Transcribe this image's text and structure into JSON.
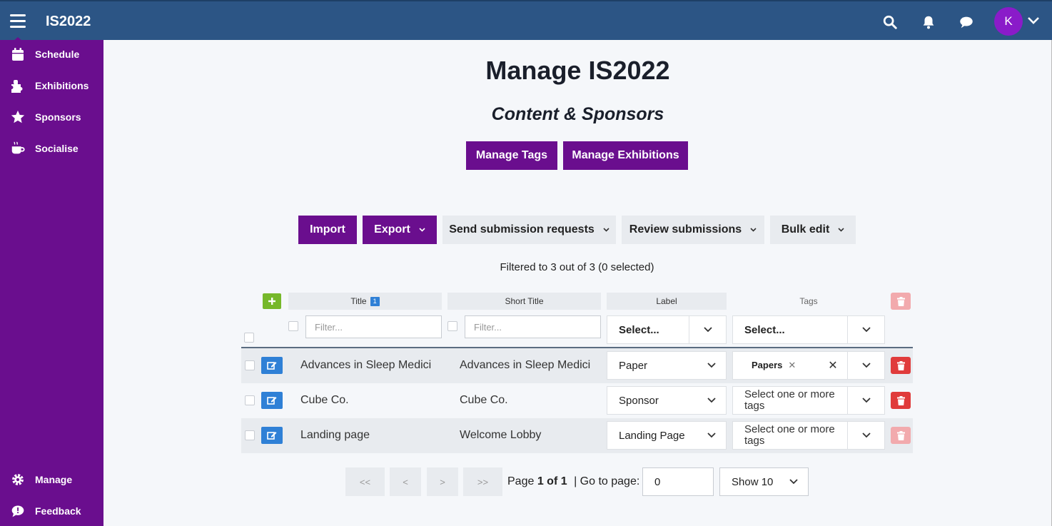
{
  "app": {
    "title": "IS2022",
    "avatar_initial": "K"
  },
  "topbar_icons": [
    "search-icon",
    "bell-icon",
    "chat-icon"
  ],
  "sidebar": {
    "items": [
      {
        "label": "Schedule",
        "icon": "calendar-icon"
      },
      {
        "label": "Exhibitions",
        "icon": "puzzle-icon"
      },
      {
        "label": "Sponsors",
        "icon": "star-icon"
      },
      {
        "label": "Socialise",
        "icon": "coffee-icon"
      }
    ],
    "bottom_items": [
      {
        "label": "Manage",
        "icon": "gear-icon"
      },
      {
        "label": "Feedback",
        "icon": "feedback-icon"
      }
    ]
  },
  "page": {
    "title": "Manage IS2022",
    "subtitle": "Content & Sponsors",
    "manage_tags": "Manage Tags",
    "manage_exhibitions": "Manage Exhibitions"
  },
  "toolbar": {
    "import": "Import",
    "export": "Export",
    "send_requests": "Send submission requests",
    "review": "Review submissions",
    "bulk_edit": "Bulk edit"
  },
  "filter_summary": "Filtered to 3 out of 3 (0 selected)",
  "table": {
    "headers": {
      "title": "Title",
      "sort_badge": "1",
      "short_title": "Short Title",
      "label": "Label",
      "tags": "Tags"
    },
    "filter_placeholder": "Filter...",
    "select_placeholder": "Select...",
    "rows": [
      {
        "title": "Advances in Sleep Medicine",
        "short_title": "Advances in Sleep Medicine",
        "label": "Paper",
        "tag": "Papers",
        "tags_placeholder": ""
      },
      {
        "title": "Cube Co.",
        "short_title": "Cube Co.",
        "label": "Sponsor",
        "tag": "",
        "tags_placeholder": "Select one or more tags"
      },
      {
        "title": "Landing page",
        "short_title": "Welcome Lobby",
        "label": "Landing Page",
        "tag": "",
        "tags_placeholder": "Select one or more tags"
      }
    ]
  },
  "pagination": {
    "first": "<<",
    "prev": "<",
    "next": ">",
    "last": ">>",
    "page_prefix": "Page",
    "page_current": "1 of 1",
    "goto_label": "| Go to page:",
    "goto_value": "0",
    "show": "Show 10"
  },
  "colors": {
    "topbar": "#2c5585",
    "sidebar": "#6a0e8e",
    "accent": "#6a0e8e",
    "add": "#76b82a",
    "edit": "#2f80d6",
    "delete": "#e03b3b"
  }
}
